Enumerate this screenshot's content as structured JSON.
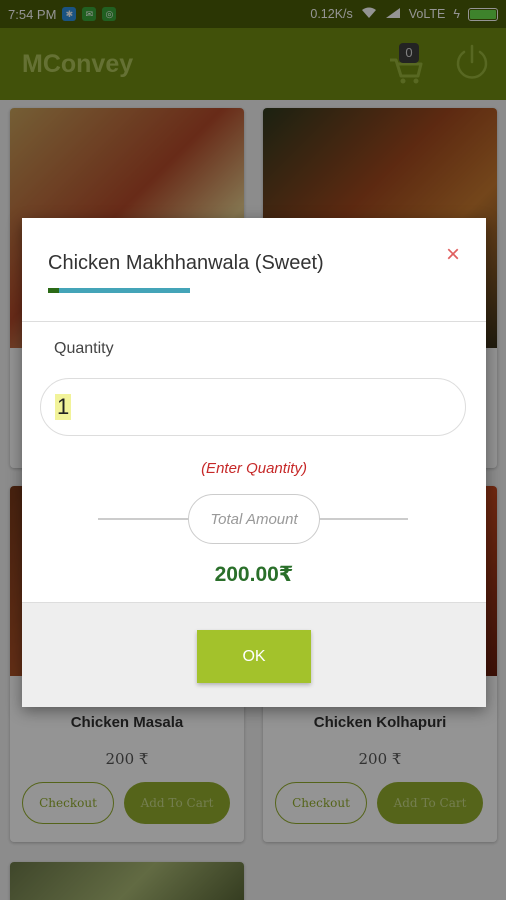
{
  "status_bar": {
    "time": "7:54 PM",
    "speed": "0.12K/s",
    "network": "VoLTE"
  },
  "app_bar": {
    "title": "MConvey",
    "cart_count": "0",
    "icons": [
      "cart-icon",
      "power-icon"
    ]
  },
  "products": [
    {
      "name": "Chicken Masala",
      "price": "200 ₹",
      "checkout_label": "Checkout",
      "add_label": "Add To Cart"
    },
    {
      "name": "Chicken Kolhapuri",
      "price": "200 ₹",
      "checkout_label": "Checkout",
      "add_label": "Add To Cart"
    }
  ],
  "dialog": {
    "title": "Chicken Makhhanwala (Sweet)",
    "close_icon": "close-icon",
    "progress_fraction": 0.08,
    "quantity_label": "Quantity",
    "quantity_value": "1",
    "hint": "(Enter Quantity)",
    "total_label": "Total Amount",
    "total_value": "200.00₹",
    "ok_label": "OK"
  },
  "colors": {
    "app_bar": "#708c12",
    "accent": "#93ad2d",
    "ok_button": "#a3c22b",
    "hint": "#c62828",
    "total_value": "#2a6f2a",
    "close": "#e06060",
    "progress": "#44a4b8"
  }
}
